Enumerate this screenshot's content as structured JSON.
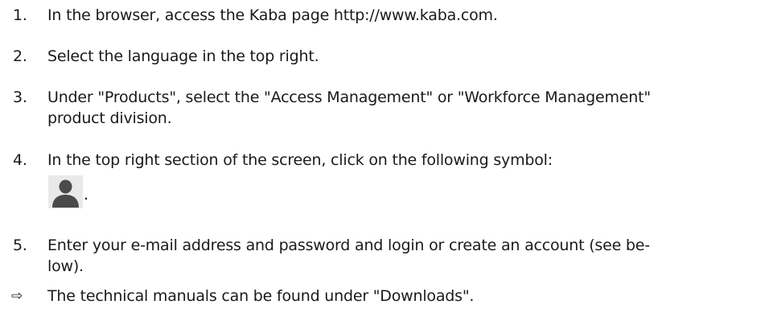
{
  "steps": [
    {
      "number": "1.",
      "text": "In the browser, access the Kaba page http://www.kaba.com."
    },
    {
      "number": "2.",
      "text": "Select the language in the top right."
    },
    {
      "number": "3.",
      "text_line1": "Under \"Products\", select the \"Access Management\" or \"Workforce Management\"",
      "text_line2": "product division."
    },
    {
      "number": "4.",
      "text": "In the top right section of the screen, click on the following symbol:",
      "icon": "user-icon",
      "trailing": "."
    },
    {
      "number": "5.",
      "text_line1": "Enter your e-mail address and password and login or create an account (see be-",
      "text_line2": "low)."
    }
  ],
  "result": {
    "marker": "⇨",
    "text": "The technical manuals can be found under \"Downloads\"."
  },
  "colors": {
    "text": "#1a1a1a",
    "icon_fill": "#4a4a4a",
    "icon_background": "#e9e9e9"
  }
}
